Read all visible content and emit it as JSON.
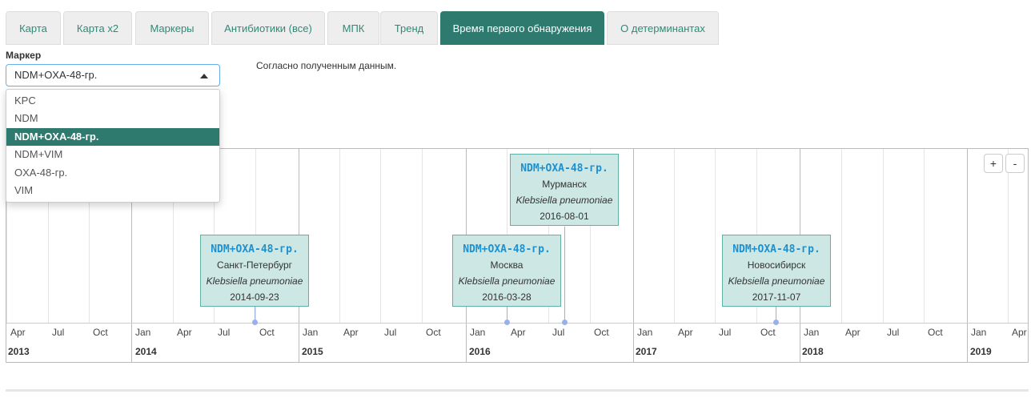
{
  "tabs": [
    {
      "label": "Карта",
      "active": false
    },
    {
      "label": "Карта x2",
      "active": false
    },
    {
      "label": "Маркеры",
      "active": false
    },
    {
      "label": "Антибиотики (все)",
      "active": false
    },
    {
      "label": "МПК",
      "active": false
    },
    {
      "label": "Тренд",
      "active": false
    },
    {
      "label": "Время первого обнаружения",
      "active": true
    },
    {
      "label": "О детерминантах",
      "active": false
    }
  ],
  "filter": {
    "label": "Маркер",
    "selected": "NDM+OXA-48-гр.",
    "options": [
      "KPC",
      "NDM",
      "NDM+OXA-48-гр.",
      "NDM+VIM",
      "OXA-48-гр.",
      "VIM"
    ]
  },
  "note": "Согласно полученным данным.",
  "timeline": {
    "zoom_in": "+",
    "zoom_out": "-",
    "month_ticks": [
      "Apr",
      "Jul",
      "Oct",
      "Jan",
      "Apr",
      "Jul",
      "Oct",
      "Jan",
      "Apr",
      "Jul",
      "Oct",
      "Jan",
      "Apr",
      "Jul",
      "Oct",
      "Jan",
      "Apr",
      "Jul",
      "Oct",
      "Jan",
      "Apr",
      "Jul",
      "Oct",
      "Jan",
      "Apr"
    ],
    "years": [
      "2013",
      "2014",
      "2015",
      "2016",
      "2017",
      "2018",
      "2019"
    ],
    "events": [
      {
        "marker": "NDM+OXA-48-гр.",
        "city": "Санкт-Петербург",
        "organism": "Klebsiella pneumoniae",
        "date": "2014-09-23"
      },
      {
        "marker": "NDM+OXA-48-гр.",
        "city": "Москва",
        "organism": "Klebsiella pneumoniae",
        "date": "2016-03-28"
      },
      {
        "marker": "NDM+OXA-48-гр.",
        "city": "Мурманск",
        "organism": "Klebsiella pneumoniae",
        "date": "2016-08-01"
      },
      {
        "marker": "NDM+OXA-48-гр.",
        "city": "Новосибирск",
        "organism": "Klebsiella pneumoniae",
        "date": "2017-11-07"
      }
    ]
  }
}
